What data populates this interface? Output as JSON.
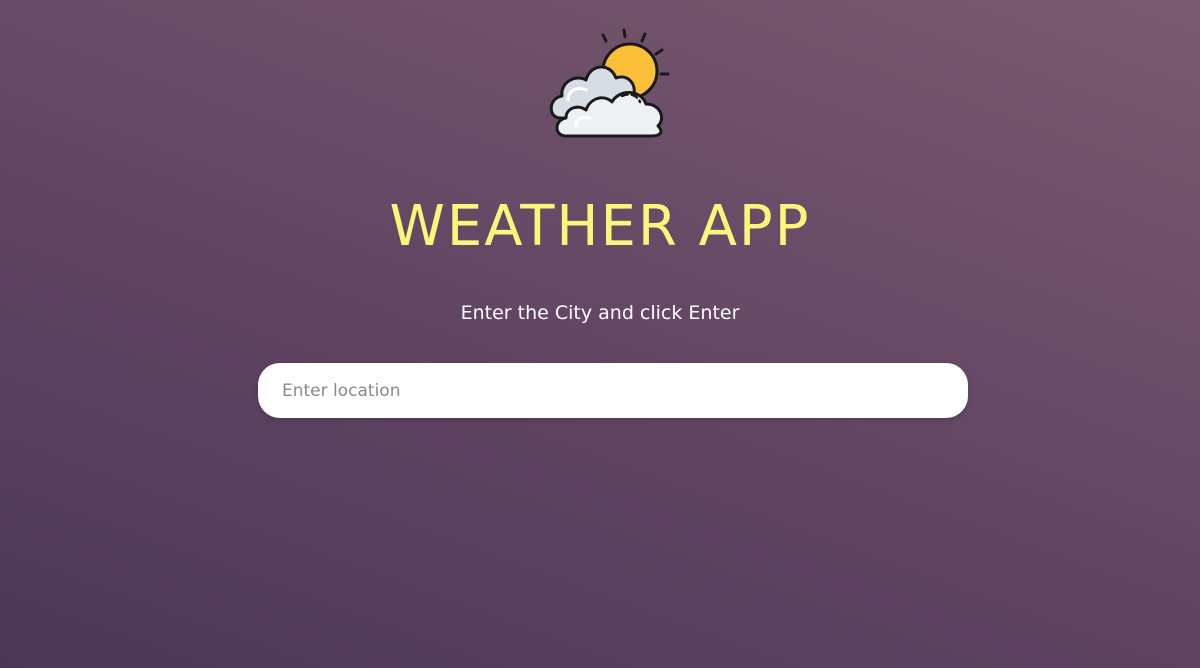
{
  "logo": {
    "icon": "sun-behind-clouds-icon"
  },
  "header": {
    "title": "WEATHER APP"
  },
  "instructions": {
    "text": "Enter the City and click Enter"
  },
  "search": {
    "placeholder": "Enter location",
    "value": ""
  },
  "colors": {
    "title": "#fbf57a",
    "background_top": "#7b5a6f",
    "background_bottom": "#4c3757",
    "input_background": "#ffffff"
  }
}
